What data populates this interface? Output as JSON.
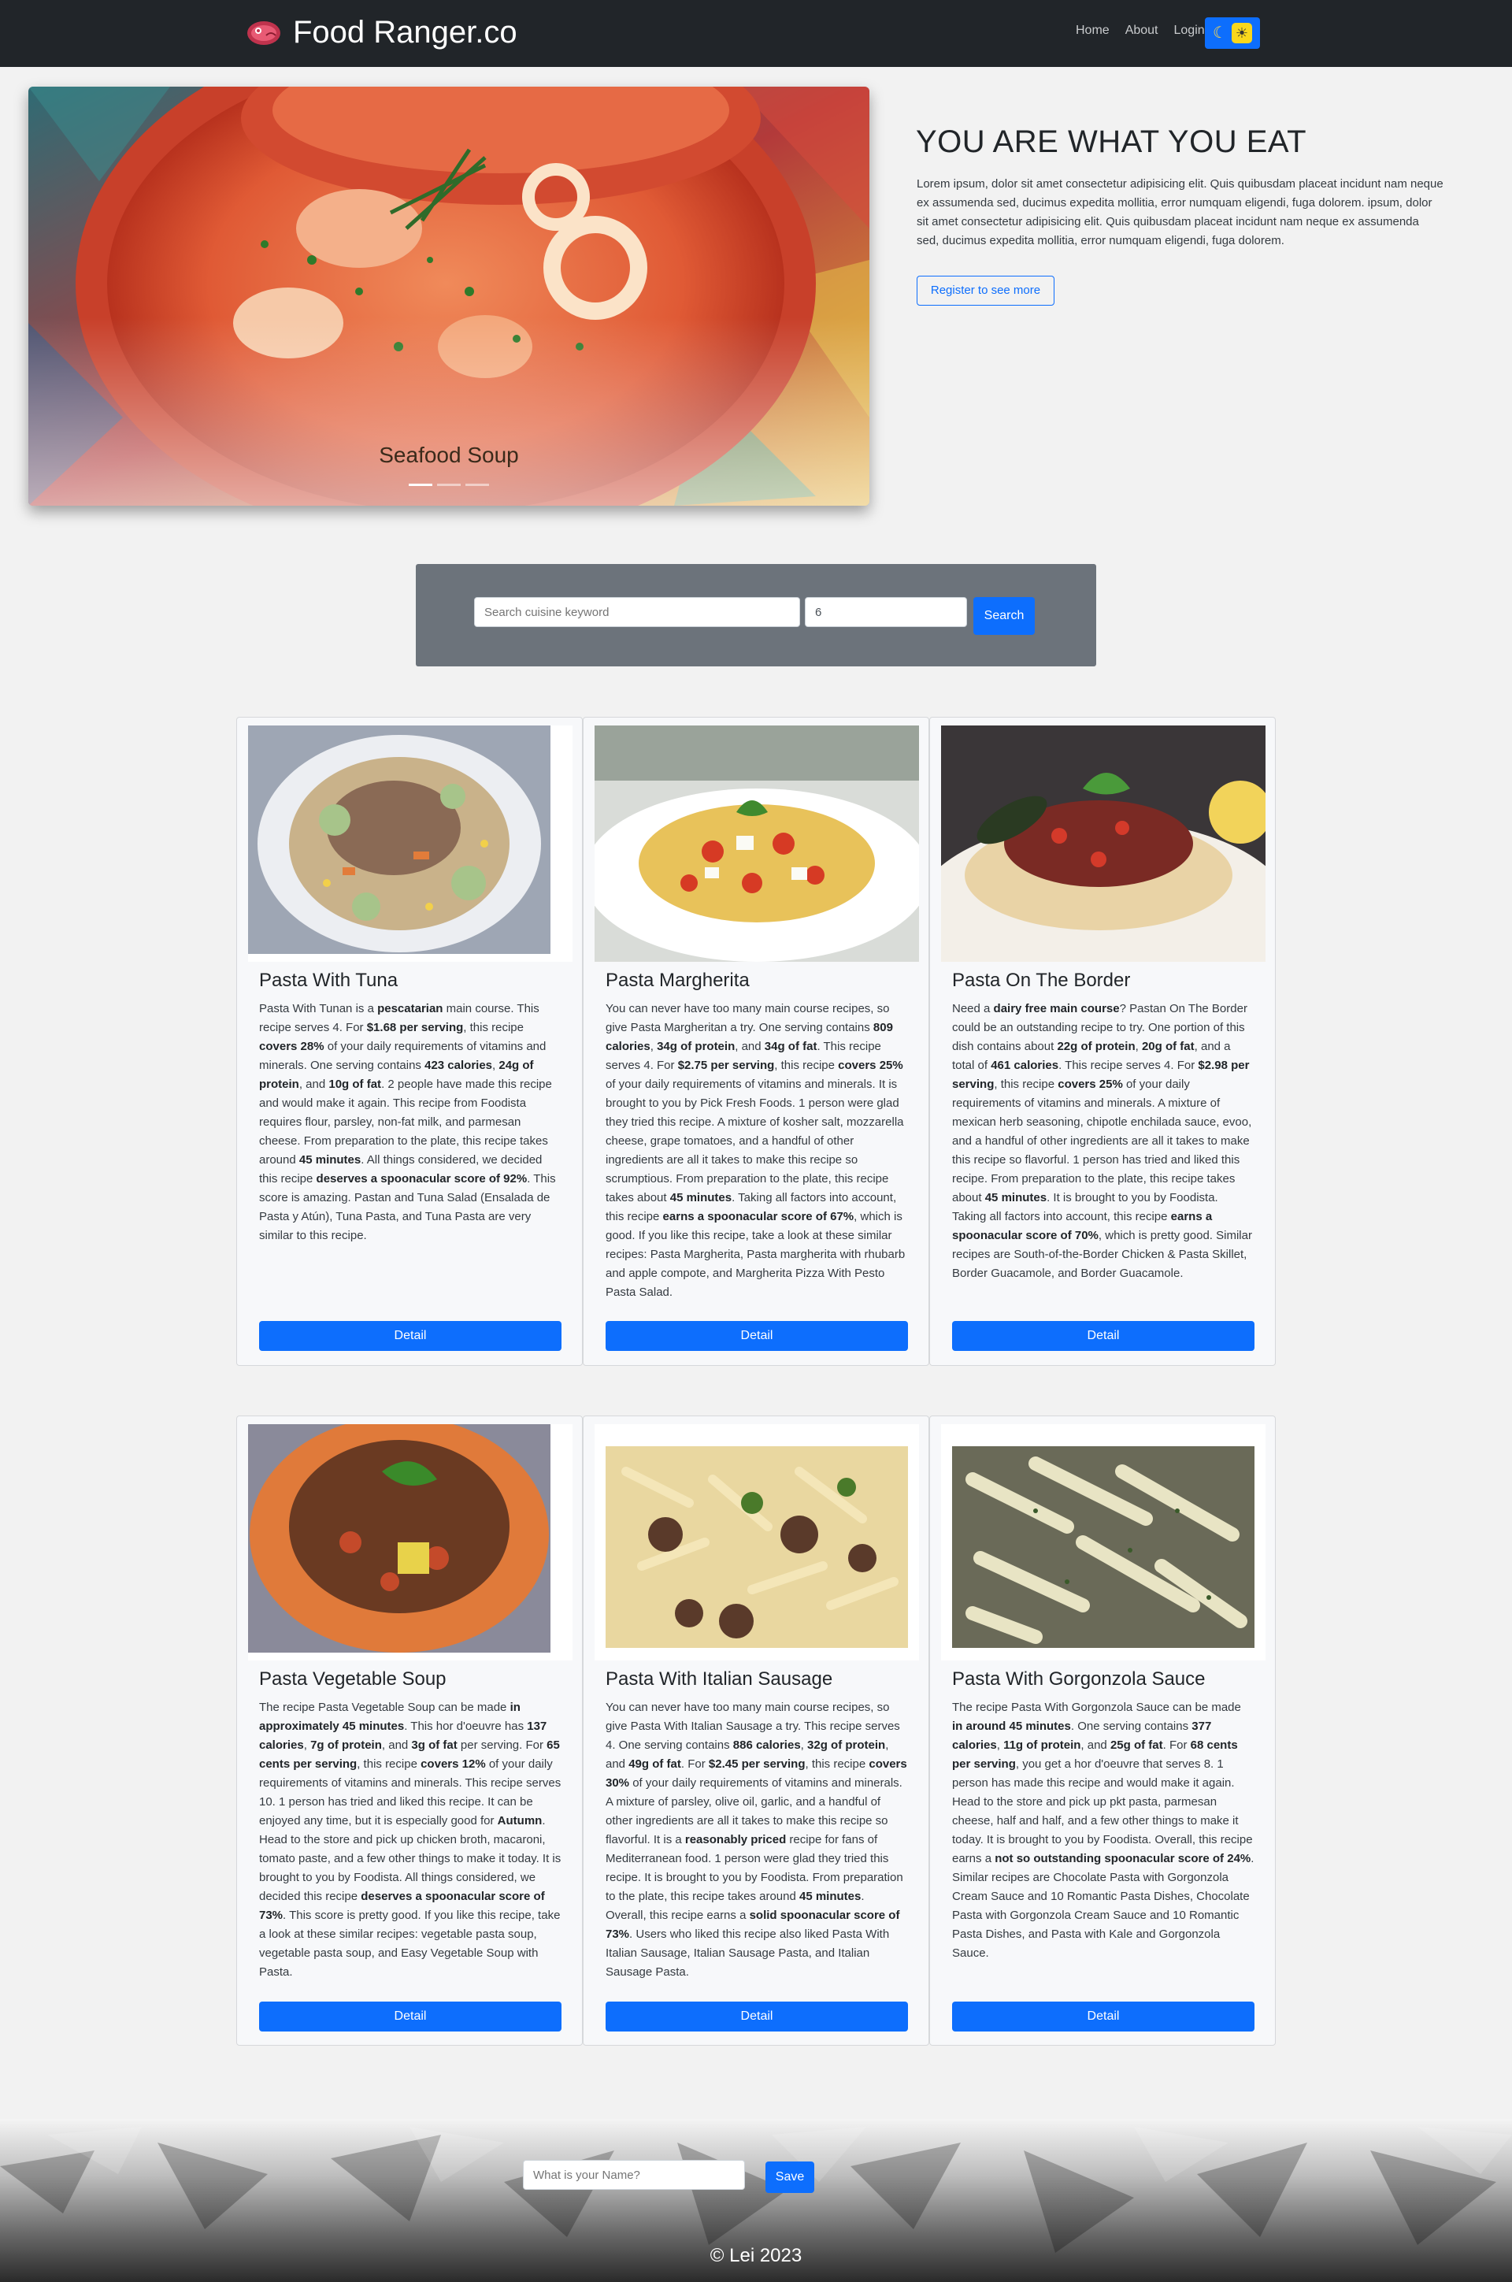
{
  "nav": {
    "brand": "Food Ranger.co",
    "links": [
      "Home",
      "About",
      "Login"
    ],
    "theme_toggle_icons": [
      "moon-icon",
      "sun-icon"
    ]
  },
  "hero": {
    "slide_caption": "Seafood Soup",
    "slide_count": 3,
    "active_slide": 1,
    "title": "YOU ARE WHAT YOU EAT",
    "text": "Lorem ipsum, dolor sit amet consectetur adipisicing elit. Quis quibusdam placeat incidunt nam neque ex assumenda sed, ducimus expedita mollitia, error numquam eligendi, fuga dolorem. ipsum, dolor sit amet consectetur adipisicing elit. Quis quibusdam placeat incidunt nam neque ex assumenda sed, ducimus expedita mollitia, error numquam eligendi, fuga dolorem.",
    "button_label": "Register to see more"
  },
  "search": {
    "keyword_placeholder": "Search cuisine keyword",
    "keyword_value": "",
    "count_value": "6",
    "button_label": "Search"
  },
  "recipes": [
    {
      "title": "Pasta With Tuna",
      "description_html": "Pasta With Tunan is a <b>pescatarian</b> main course. This recipe serves 4. For <b>$1.68 per serving</b>, this recipe <b>covers 28%</b> of your daily requirements of vitamins and minerals. One serving contains <b>423 calories</b>, <b>24g of protein</b>, and <b>10g of fat</b>. 2 people have made this recipe and would make it again. This recipe from Foodista requires flour, parsley, non-fat milk, and parmesan cheese. From preparation to the plate, this recipe takes around <b>45 minutes</b>. All things considered, we decided this recipe <b>deserves a spoonacular score of 92%</b>. This score is amazing. Pastan and Tuna Salad (Ensalada de Pasta y Atún), Tuna Pasta, and Tuna Pasta are very similar to this recipe.",
      "button_label": "Detail"
    },
    {
      "title": "Pasta Margherita",
      "description_html": "You can never have too many main course recipes, so give Pasta Margheritan a try. One serving contains <b>809 calories</b>, <b>34g of protein</b>, and <b>34g of fat</b>. This recipe serves 4. For <b>$2.75 per serving</b>, this recipe <b>covers 25%</b> of your daily requirements of vitamins and minerals. It is brought to you by Pick Fresh Foods. 1 person were glad they tried this recipe. A mixture of kosher salt, mozzarella cheese, grape tomatoes, and a handful of other ingredients are all it takes to make this recipe so scrumptious. From preparation to the plate, this recipe takes about <b>45 minutes</b>. Taking all factors into account, this recipe <b>earns a spoonacular score of 67%</b>, which is good. If you like this recipe, take a look at these similar recipes: Pasta Margherita, Pasta margherita with rhubarb and apple compote, and Margherita Pizza With Pesto Pasta Salad.",
      "button_label": "Detail"
    },
    {
      "title": "Pasta On The Border",
      "description_html": "Need a <b>dairy free main course</b>? Pastan On The Border could be an outstanding recipe to try. One portion of this dish contains about <b>22g of protein</b>, <b>20g of fat</b>, and a total of <b>461 calories</b>. This recipe serves 4. For <b>$2.98 per serving</b>, this recipe <b>covers 25%</b> of your daily requirements of vitamins and minerals. A mixture of mexican herb seasoning, chipotle enchilada sauce, evoo, and a handful of other ingredients are all it takes to make this recipe so flavorful. 1 person has tried and liked this recipe. From preparation to the plate, this recipe takes about <b>45 minutes</b>. It is brought to you by Foodista. Taking all factors into account, this recipe <b>earns a spoonacular score of 70%</b>, which is pretty good. Similar recipes are South-of-the-Border Chicken &amp; Pasta Skillet, Border Guacamole, and Border Guacamole.",
      "button_label": "Detail"
    },
    {
      "title": "Pasta Vegetable Soup",
      "description_html": "The recipe Pasta Vegetable Soup can be made <b>in approximately 45 minutes</b>. This hor d'oeuvre has <b>137 calories</b>, <b>7g of protein</b>, and <b>3g of fat</b> per serving. For <b>65 cents per serving</b>, this recipe <b>covers 12%</b> of your daily requirements of vitamins and minerals. This recipe serves 10. 1 person has tried and liked this recipe. It can be enjoyed any time, but it is especially good for <b>Autumn</b>. Head to the store and pick up chicken broth, macaroni, tomato paste, and a few other things to make it today. It is brought to you by Foodista. All things considered, we decided this recipe <b>deserves a spoonacular score of 73%</b>. This score is pretty good. If you like this recipe, take a look at these similar recipes: vegetable pasta soup, vegetable pasta soup, and Easy Vegetable Soup with Pasta.",
      "button_label": "Detail"
    },
    {
      "title": "Pasta With Italian Sausage",
      "description_html": "You can never have too many main course recipes, so give Pasta With Italian Sausage a try. This recipe serves 4. One serving contains <b>886 calories</b>, <b>32g of protein</b>, and <b>49g of fat</b>. For <b>$2.45 per serving</b>, this recipe <b>covers 30%</b> of your daily requirements of vitamins and minerals. A mixture of parsley, olive oil, garlic, and a handful of other ingredients are all it takes to make this recipe so flavorful. It is a <b>reasonably priced</b> recipe for fans of Mediterranean food. 1 person were glad they tried this recipe. It is brought to you by Foodista. From preparation to the plate, this recipe takes around <b>45 minutes</b>. Overall, this recipe earns a <b>solid spoonacular score of 73%</b>. Users who liked this recipe also liked Pasta With Italian Sausage, Italian Sausage Pasta, and Italian Sausage Pasta.",
      "button_label": "Detail"
    },
    {
      "title": "Pasta With Gorgonzola Sauce",
      "description_html": "The recipe Pasta With Gorgonzola Sauce can be made <b>in around 45 minutes</b>. One serving contains <b>377 calories</b>, <b>11g of protein</b>, and <b>25g of fat</b>. For <b>68 cents per serving</b>, you get a hor d'oeuvre that serves 8. 1 person has made this recipe and would make it again. Head to the store and pick up pkt pasta, parmesan cheese, half and half, and a few other things to make it today. It is brought to you by Foodista. Overall, this recipe earns a <b>not so outstanding spoonacular score of 24%</b>. Similar recipes are Chocolate Pasta with Gorgonzola Cream Sauce and 10 Romantic Pasta Dishes, Chocolate Pasta with Gorgonzola Cream Sauce and 10 Romantic Pasta Dishes, and Pasta with Kale and Gorgonzola Sauce.",
      "button_label": "Detail"
    }
  ],
  "footer": {
    "name_placeholder": "What is your Name?",
    "name_value": "",
    "save_label": "Save",
    "copyright": "© Lei 2023"
  },
  "colors": {
    "navbar": "#212529",
    "primary": "#0d6efd",
    "search_panel": "#6c737b",
    "page_bg": "#f2f2f2"
  }
}
